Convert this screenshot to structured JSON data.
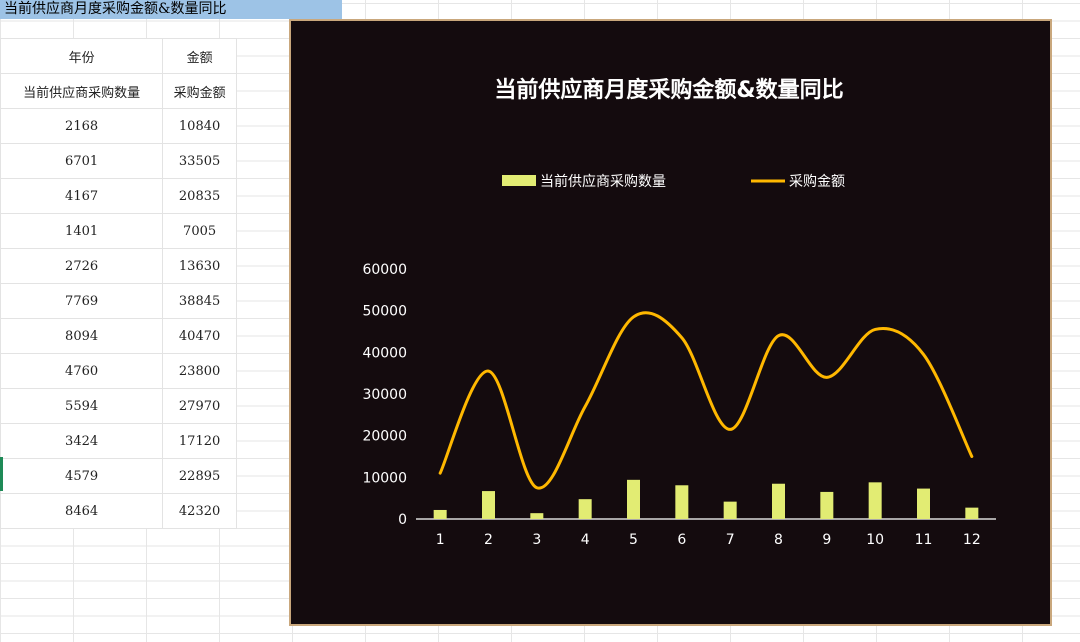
{
  "sheet": {
    "title_cell": "当前供应商月度采购金额&数量同比",
    "table": {
      "header_row1": [
        "年份",
        "金额"
      ],
      "header_row2": [
        "当前供应商采购数量",
        "采购金额"
      ],
      "rows": [
        [
          "2168",
          "10840"
        ],
        [
          "6701",
          "33505"
        ],
        [
          "4167",
          "20835"
        ],
        [
          "1401",
          "7005"
        ],
        [
          "2726",
          "13630"
        ],
        [
          "7769",
          "38845"
        ],
        [
          "8094",
          "40470"
        ],
        [
          "4760",
          "23800"
        ],
        [
          "5594",
          "27970"
        ],
        [
          "3424",
          "17120"
        ],
        [
          "4579",
          "22895"
        ],
        [
          "8464",
          "42320"
        ]
      ]
    }
  },
  "chart_data": {
    "type": "bar+line",
    "title": "当前供应商月度采购金额&数量同比",
    "categories": [
      "1",
      "2",
      "3",
      "4",
      "5",
      "6",
      "7",
      "8",
      "9",
      "10",
      "11",
      "12"
    ],
    "series": [
      {
        "name": "当前供应商采购数量",
        "kind": "bar",
        "color": "#e2ec73",
        "values": [
          2168,
          6701,
          1401,
          4760,
          9400,
          8094,
          4167,
          8464,
          6500,
          8800,
          7300,
          2726
        ]
      },
      {
        "name": "采购金额",
        "kind": "line",
        "smooth": true,
        "color": "#ffb800",
        "values": [
          11000,
          35500,
          7500,
          27000,
          48500,
          43500,
          21500,
          44000,
          34000,
          45500,
          39500,
          15000
        ]
      }
    ],
    "ylim": [
      0,
      60000
    ],
    "yticks": [
      "0",
      "10000",
      "20000",
      "30000",
      "40000",
      "50000",
      "60000"
    ],
    "legend_position": "top",
    "grid": false,
    "background": "#140b0e"
  }
}
